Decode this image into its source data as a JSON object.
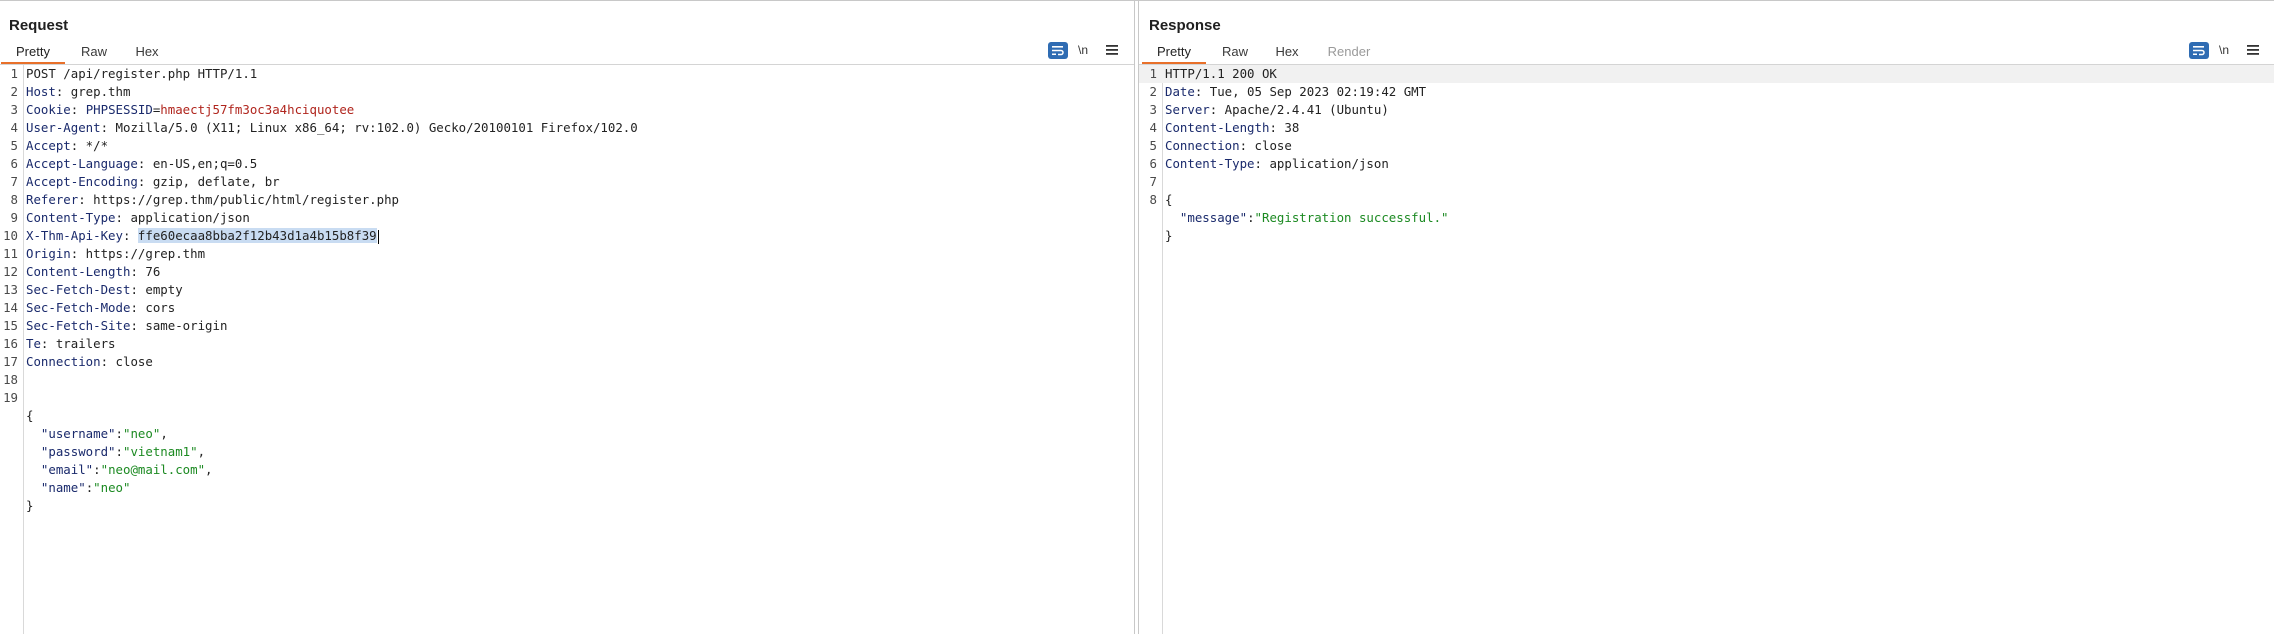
{
  "request": {
    "title": "Request",
    "tabs": [
      {
        "label": "Pretty"
      },
      {
        "label": "Raw"
      },
      {
        "label": "Hex"
      }
    ],
    "wrap_label": "\\n",
    "lines": [
      {
        "n": "1",
        "parts": [
          {
            "t": "POST /api/register.php HTTP/1.1",
            "c": "v"
          }
        ]
      },
      {
        "n": "2",
        "parts": [
          {
            "t": "Host",
            "c": "k"
          },
          {
            "t": ": grep.thm",
            "c": "v"
          }
        ]
      },
      {
        "n": "3",
        "parts": [
          {
            "t": "Cookie",
            "c": "k"
          },
          {
            "t": ": ",
            "c": "v"
          },
          {
            "t": "PHPSESSID",
            "c": "k"
          },
          {
            "t": "=",
            "c": "v"
          },
          {
            "t": "hmaectj57fm3oc3a4hciquotee",
            "c": "c"
          }
        ]
      },
      {
        "n": "4",
        "parts": [
          {
            "t": "User-Agent",
            "c": "k"
          },
          {
            "t": ": Mozilla/5.0 (X11; Linux x86_64; rv:102.0) Gecko/20100101 Firefox/102.0",
            "c": "v"
          }
        ]
      },
      {
        "n": "5",
        "parts": [
          {
            "t": "Accept",
            "c": "k"
          },
          {
            "t": ": */*",
            "c": "v"
          }
        ]
      },
      {
        "n": "6",
        "parts": [
          {
            "t": "Accept-Language",
            "c": "k"
          },
          {
            "t": ": en-US,en;q=0.5",
            "c": "v"
          }
        ]
      },
      {
        "n": "7",
        "parts": [
          {
            "t": "Accept-Encoding",
            "c": "k"
          },
          {
            "t": ": gzip, deflate, br",
            "c": "v"
          }
        ]
      },
      {
        "n": "8",
        "parts": [
          {
            "t": "Referer",
            "c": "k"
          },
          {
            "t": ": https://grep.thm/public/html/register.php",
            "c": "v"
          }
        ]
      },
      {
        "n": "9",
        "parts": [
          {
            "t": "Content-Type",
            "c": "k"
          },
          {
            "t": ": application/json",
            "c": "v"
          }
        ]
      },
      {
        "n": "10",
        "parts": [
          {
            "t": "X-Thm-Api-Key",
            "c": "k"
          },
          {
            "t": ": ",
            "c": "v"
          },
          {
            "t": "ffe60ecaa8bba2f12b43d1a4b15b8f39",
            "c": "v sel"
          }
        ],
        "caret": true
      },
      {
        "n": "11",
        "parts": [
          {
            "t": "Origin",
            "c": "k"
          },
          {
            "t": ": https://grep.thm",
            "c": "v"
          }
        ]
      },
      {
        "n": "12",
        "parts": [
          {
            "t": "Content-Length",
            "c": "k"
          },
          {
            "t": ": 76",
            "c": "v"
          }
        ]
      },
      {
        "n": "13",
        "parts": [
          {
            "t": "Sec-Fetch-Dest",
            "c": "k"
          },
          {
            "t": ": empty",
            "c": "v"
          }
        ]
      },
      {
        "n": "14",
        "parts": [
          {
            "t": "Sec-Fetch-Mode",
            "c": "k"
          },
          {
            "t": ": cors",
            "c": "v"
          }
        ]
      },
      {
        "n": "15",
        "parts": [
          {
            "t": "Sec-Fetch-Site",
            "c": "k"
          },
          {
            "t": ": same-origin",
            "c": "v"
          }
        ]
      },
      {
        "n": "16",
        "parts": [
          {
            "t": "Te",
            "c": "k"
          },
          {
            "t": ": trailers",
            "c": "v"
          }
        ]
      },
      {
        "n": "17",
        "parts": [
          {
            "t": "Connection",
            "c": "k"
          },
          {
            "t": ": close",
            "c": "v"
          }
        ]
      },
      {
        "n": "18",
        "parts": []
      },
      {
        "n": "19",
        "parts": []
      },
      {
        "n": "",
        "parts": [
          {
            "t": "{",
            "c": "v"
          }
        ]
      },
      {
        "n": "",
        "parts": [
          {
            "t": "  ",
            "c": "v"
          },
          {
            "t": "\"username\"",
            "c": "jk"
          },
          {
            "t": ":",
            "c": "v"
          },
          {
            "t": "\"neo\"",
            "c": "str"
          },
          {
            "t": ",",
            "c": "v"
          }
        ]
      },
      {
        "n": "",
        "parts": [
          {
            "t": "  ",
            "c": "v"
          },
          {
            "t": "\"password\"",
            "c": "jk"
          },
          {
            "t": ":",
            "c": "v"
          },
          {
            "t": "\"vietnam1\"",
            "c": "str"
          },
          {
            "t": ",",
            "c": "v"
          }
        ]
      },
      {
        "n": "",
        "parts": [
          {
            "t": "  ",
            "c": "v"
          },
          {
            "t": "\"email\"",
            "c": "jk"
          },
          {
            "t": ":",
            "c": "v"
          },
          {
            "t": "\"neo@mail.com\"",
            "c": "str"
          },
          {
            "t": ",",
            "c": "v"
          }
        ]
      },
      {
        "n": "",
        "parts": [
          {
            "t": "  ",
            "c": "v"
          },
          {
            "t": "\"name\"",
            "c": "jk"
          },
          {
            "t": ":",
            "c": "v"
          },
          {
            "t": "\"neo\"",
            "c": "str"
          }
        ]
      },
      {
        "n": "",
        "parts": [
          {
            "t": "}",
            "c": "v"
          }
        ]
      }
    ]
  },
  "response": {
    "title": "Response",
    "tabs": [
      {
        "label": "Pretty"
      },
      {
        "label": "Raw"
      },
      {
        "label": "Hex"
      },
      {
        "label": "Render"
      }
    ],
    "wrap_label": "\\n",
    "lines": [
      {
        "n": "1",
        "parts": [
          {
            "t": "HTTP/1.1 200 OK",
            "c": "v"
          }
        ],
        "hl": true
      },
      {
        "n": "2",
        "parts": [
          {
            "t": "Date",
            "c": "k"
          },
          {
            "t": ": Tue, 05 Sep 2023 02:19:42 GMT",
            "c": "v"
          }
        ]
      },
      {
        "n": "3",
        "parts": [
          {
            "t": "Server",
            "c": "k"
          },
          {
            "t": ": Apache/2.4.41 (Ubuntu)",
            "c": "v"
          }
        ]
      },
      {
        "n": "4",
        "parts": [
          {
            "t": "Content-Length",
            "c": "k"
          },
          {
            "t": ": 38",
            "c": "v"
          }
        ]
      },
      {
        "n": "5",
        "parts": [
          {
            "t": "Connection",
            "c": "k"
          },
          {
            "t": ": close",
            "c": "v"
          }
        ]
      },
      {
        "n": "6",
        "parts": [
          {
            "t": "Content-Type",
            "c": "k"
          },
          {
            "t": ": application/json",
            "c": "v"
          }
        ]
      },
      {
        "n": "7",
        "parts": []
      },
      {
        "n": "8",
        "parts": [
          {
            "t": "{",
            "c": "v"
          }
        ]
      },
      {
        "n": "",
        "parts": [
          {
            "t": "  ",
            "c": "v"
          },
          {
            "t": "\"message\"",
            "c": "jk"
          },
          {
            "t": ":",
            "c": "v"
          },
          {
            "t": "\"Registration successful.\"",
            "c": "str"
          }
        ]
      },
      {
        "n": "",
        "parts": [
          {
            "t": "}",
            "c": "v"
          }
        ]
      }
    ]
  },
  "colors": {
    "accent": "#e8702a",
    "toggle_blue": "#2f6cb3",
    "selection": "#c9dcf2"
  }
}
